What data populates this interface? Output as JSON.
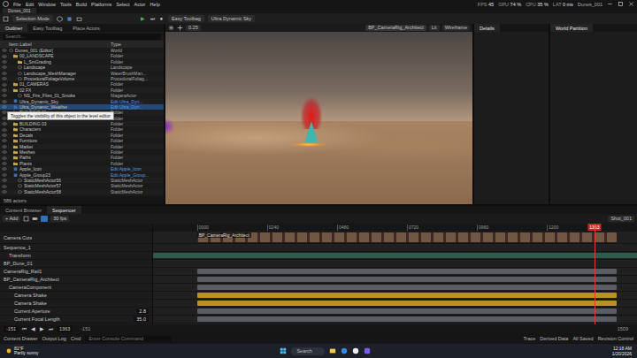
{
  "window": {
    "title": "Dunes_001"
  },
  "menu": [
    "File",
    "Edit",
    "Window",
    "Tools",
    "Build",
    "Platforms",
    "Select",
    "Actor",
    "Help"
  ],
  "stats": [
    {
      "label": "FPS",
      "value": "45"
    },
    {
      "label": "GPU",
      "value": "74 %"
    },
    {
      "label": "CPU",
      "value": "35 %"
    },
    {
      "label": "LAT",
      "value": "0 ms"
    }
  ],
  "project": "Dunes_001",
  "toolbar": {
    "mode": "Selection Mode",
    "play_buttons": [
      "▶",
      "⏭",
      "⏹"
    ],
    "items": [
      "Easy Toolbag",
      "Ultra Dynamic Sky"
    ]
  },
  "outliner": {
    "tabs": [
      {
        "label": "Outliner",
        "selected": true
      },
      {
        "label": "Easy Toolbag",
        "selected": false
      },
      {
        "label": "Place Actors",
        "selected": false
      }
    ],
    "search": "Search...",
    "columns": [
      "Item Label",
      "Type"
    ],
    "rows": [
      {
        "label": "Dunes_001 (Editor)",
        "type": "World",
        "depth": 0,
        "kind": "world",
        "selected": false
      },
      {
        "label": "00_LANDSCAPE",
        "type": "Folder",
        "depth": 1,
        "kind": "folder",
        "selected": false
      },
      {
        "label": "L_SmGrading",
        "type": "Folder",
        "depth": 2,
        "kind": "folder",
        "selected": false
      },
      {
        "label": "Landscape",
        "type": "Landscape",
        "depth": 2,
        "kind": "actor",
        "selected": false
      },
      {
        "label": "Landscape_MeshManager",
        "type": "WaterBrushMan...",
        "depth": 2,
        "kind": "actor",
        "selected": false
      },
      {
        "label": "ProceduralFoliageVolume",
        "type": "ProceduralFoliag...",
        "depth": 2,
        "kind": "actor",
        "selected": false
      },
      {
        "label": "01_CAMERAS",
        "type": "Folder",
        "depth": 1,
        "kind": "folder",
        "selected": false
      },
      {
        "label": "02 FX",
        "type": "Folder",
        "depth": 1,
        "kind": "folder",
        "selected": false
      },
      {
        "label": "NS_Fire_Flies_01_Smoke",
        "type": "NiagaraActor",
        "depth": 2,
        "kind": "actor",
        "selected": false
      },
      {
        "label": "Ultra_Dynamic_Sky",
        "type": "Edit Ultra_Dyn...",
        "depth": 1,
        "kind": "blueprint",
        "selected": false
      },
      {
        "label": "Ultra_Dynamic_Weather",
        "type": "Edit Ultra_Dyn...",
        "depth": 1,
        "kind": "blueprint",
        "selected": true
      },
      {
        "label": "BUILDING 01",
        "type": "Folder",
        "depth": 1,
        "kind": "folder",
        "selected": false
      },
      {
        "label": "BUILDING 02",
        "type": "Folder",
        "depth": 1,
        "kind": "folder",
        "selected": false
      },
      {
        "label": "BUILDING 03",
        "type": "Folder",
        "depth": 1,
        "kind": "folder",
        "selected": false
      },
      {
        "label": "Characters",
        "type": "Folder",
        "depth": 1,
        "kind": "folder",
        "selected": false
      },
      {
        "label": "Decals",
        "type": "Folder",
        "depth": 1,
        "kind": "folder",
        "selected": false
      },
      {
        "label": "Furniture",
        "type": "Folder",
        "depth": 1,
        "kind": "folder",
        "selected": false
      },
      {
        "label": "Market",
        "type": "Folder",
        "depth": 1,
        "kind": "folder",
        "selected": false
      },
      {
        "label": "Meshes",
        "type": "Folder",
        "depth": 1,
        "kind": "folder",
        "selected": false
      },
      {
        "label": "Paths",
        "type": "Folder",
        "depth": 1,
        "kind": "folder",
        "selected": false
      },
      {
        "label": "Plants",
        "type": "Folder",
        "depth": 1,
        "kind": "folder",
        "selected": false
      },
      {
        "label": "Apple_Icon",
        "type": "Edit Apple_Icon",
        "depth": 1,
        "kind": "blueprint",
        "selected": false
      },
      {
        "label": "Apple_Group23",
        "type": "Edit Apple_Group...",
        "depth": 1,
        "kind": "blueprint",
        "selected": false
      },
      {
        "label": "StaticMeshActor56",
        "type": "StaticMeshActor",
        "depth": 2,
        "kind": "actor",
        "selected": false
      },
      {
        "label": "StaticMeshActor57",
        "type": "StaticMeshActor",
        "depth": 2,
        "kind": "actor",
        "selected": false
      },
      {
        "label": "StaticMeshActor58",
        "type": "StaticMeshActor",
        "depth": 2,
        "kind": "actor",
        "selected": false
      }
    ],
    "tooltip": "Toggles the visibility of this object in the level editor",
    "footer": "586 actors"
  },
  "viewport": {
    "zoom": "0.25",
    "camera": "BP_CameraRig_Architect",
    "view_mode": "Lit",
    "show": "Wireframe"
  },
  "details": {
    "title": "Details"
  },
  "world_partition": {
    "title": "World Partition"
  },
  "sequencer": {
    "tabs": [
      {
        "label": "Content Browser",
        "selected": false
      },
      {
        "label": "Sequencer",
        "selected": true
      }
    ],
    "add": "+ Add",
    "fps": "30 fps",
    "shot": "Shot_001",
    "timeline": {
      "view_start": -151,
      "view_end": 1509,
      "playhead": 1363,
      "playhead_label": "1363",
      "ticks": [
        {
          "frame": 0,
          "label": "0000"
        },
        {
          "frame": 240,
          "label": "0240"
        },
        {
          "frame": 480,
          "label": "0480"
        },
        {
          "frame": 720,
          "label": "0720"
        },
        {
          "frame": 960,
          "label": "0960"
        },
        {
          "frame": 1200,
          "label": "1200"
        }
      ]
    },
    "tracks": [
      {
        "label": "Camera Cuts",
        "value": "",
        "depth": 0,
        "kind": "thumbnails",
        "start": 0,
        "end": 1440,
        "section": "BP_CameraRig_Architect",
        "color": "#3a2a22"
      },
      {
        "label": "Sequence_1",
        "value": "",
        "depth": 0,
        "kind": "empty",
        "start": 0,
        "end": 0,
        "section": "",
        "color": "#202020"
      },
      {
        "label": "Transform",
        "value": "",
        "depth": 1,
        "kind": "bar",
        "start": -151,
        "end": 1509,
        "section": "",
        "color": "#2e5c4b"
      },
      {
        "label": "BP_Dune_01",
        "value": "",
        "depth": 0,
        "kind": "empty",
        "start": 0,
        "end": 0,
        "section": "",
        "color": "#202020"
      },
      {
        "label": "CameraRig_Rail1",
        "value": "",
        "depth": 0,
        "kind": "bar",
        "start": 0,
        "end": 1440,
        "section": "",
        "color": "#5a5d63"
      },
      {
        "label": "BP_CameraRig_Architect",
        "value": "",
        "depth": 0,
        "kind": "bar",
        "start": 0,
        "end": 1440,
        "section": "",
        "color": "#5a5d63"
      },
      {
        "label": "CameraComponent",
        "value": "",
        "depth": 1,
        "kind": "bar",
        "start": 0,
        "end": 1440,
        "section": "",
        "color": "#5a5d63"
      },
      {
        "label": "Camera Shake",
        "value": "",
        "depth": 2,
        "kind": "bar",
        "start": 0,
        "end": 1440,
        "section": "",
        "color": "#b8931f"
      },
      {
        "label": "Camera Shake",
        "value": "",
        "depth": 2,
        "kind": "bar",
        "start": 0,
        "end": 1440,
        "section": "",
        "color": "#b8931f"
      },
      {
        "label": "Current Aperture",
        "value": "2.8",
        "depth": 2,
        "kind": "bar",
        "start": 0,
        "end": 1440,
        "section": "",
        "color": "#5a5d63"
      },
      {
        "label": "Current Focal Length",
        "value": "35.0",
        "depth": 2,
        "kind": "bar",
        "start": 0,
        "end": 1440,
        "section": "",
        "color": "#5a5d63"
      }
    ],
    "transport": {
      "start": "-151",
      "buttons": [
        "⏮",
        "◀",
        "▶",
        "⏭"
      ],
      "frame": "1363",
      "range_start": "-151",
      "range_end": "1509"
    }
  },
  "status_bar": {
    "left": [
      "Content Drawer",
      "Output Log",
      "Cmd"
    ],
    "console": "Enter Console Command",
    "right": [
      "Trace",
      "Derived Data",
      "All Saved",
      "Revision Control"
    ]
  },
  "taskbar": {
    "temperature": "81°F",
    "weather": "Partly sunny",
    "search": "Search",
    "time": "12:18 AM",
    "date": "1/20/2026"
  }
}
